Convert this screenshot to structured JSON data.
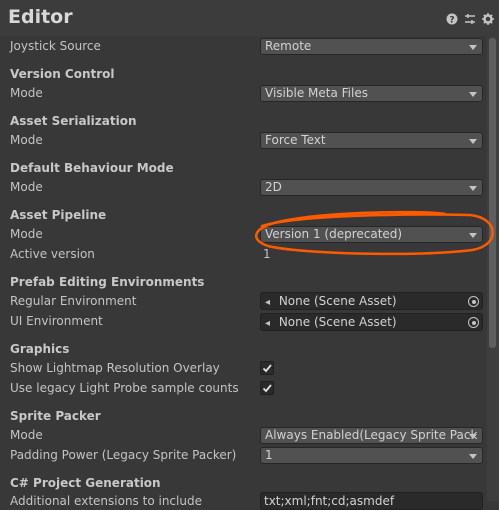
{
  "header": {
    "title": "Editor"
  },
  "rows": {
    "joystick_source": {
      "label": "Joystick Source",
      "value": "Remote"
    },
    "version_control": {
      "title": "Version Control",
      "mode_label": "Mode",
      "mode_value": "Visible Meta Files"
    },
    "asset_serialization": {
      "title": "Asset Serialization",
      "mode_label": "Mode",
      "mode_value": "Force Text"
    },
    "default_behaviour": {
      "title": "Default Behaviour Mode",
      "mode_label": "Mode",
      "mode_value": "2D"
    },
    "asset_pipeline": {
      "title": "Asset Pipeline",
      "mode_label": "Mode",
      "mode_value": "Version 1 (deprecated)",
      "active_label": "Active version",
      "active_value": "1"
    },
    "prefab_editing": {
      "title": "Prefab Editing Environments",
      "regular_label": "Regular Environment",
      "regular_value": "None (Scene Asset)",
      "ui_label": "UI Environment",
      "ui_value": "None (Scene Asset)"
    },
    "graphics": {
      "title": "Graphics",
      "lightmap_label": "Show Lightmap Resolution Overlay",
      "lightmap_checked": true,
      "lightprobe_label": "Use legacy Light Probe sample counts",
      "lightprobe_checked": true
    },
    "sprite_packer": {
      "title": "Sprite Packer",
      "mode_label": "Mode",
      "mode_value": "Always Enabled(Legacy Sprite Pack",
      "padding_label": "Padding Power (Legacy Sprite Packer)",
      "padding_value": "1"
    },
    "csharp": {
      "title": "C# Project Generation",
      "extensions_label": "Additional extensions to include",
      "extensions_value": "txt;xml;fnt;cd;asmdef"
    }
  },
  "annotation": {
    "color": "#ff5a00"
  }
}
